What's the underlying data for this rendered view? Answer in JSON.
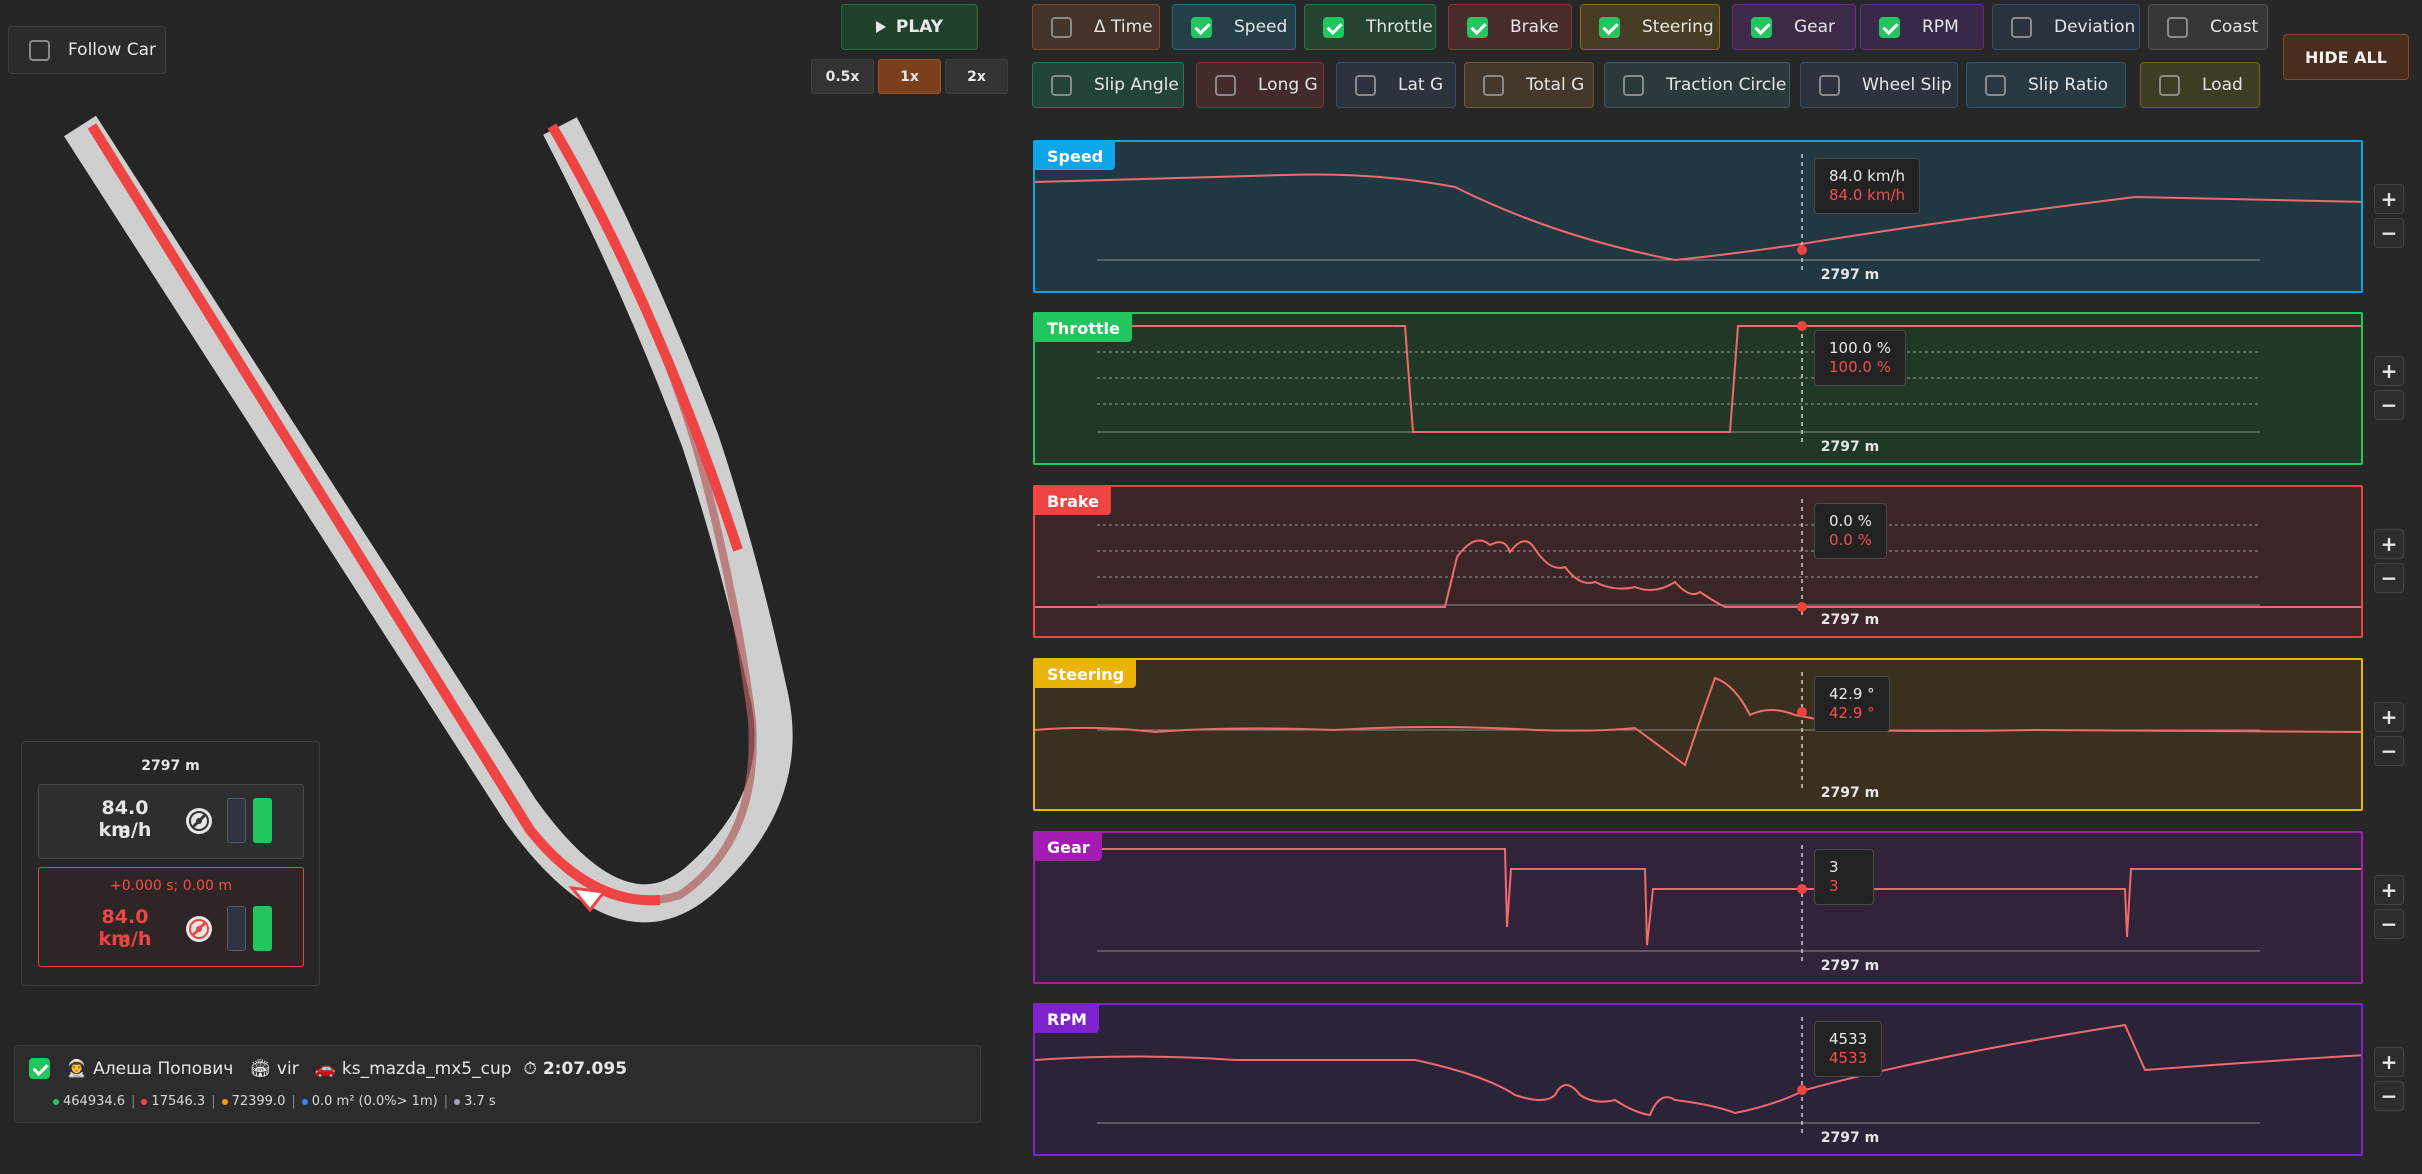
{
  "map": {
    "follow_car_label": "Follow Car",
    "follow_car_checked": false
  },
  "playback": {
    "play_label": "PLAY",
    "speeds": [
      "0.5x",
      "1x",
      "2x"
    ],
    "active_speed": "1x"
  },
  "channels": [
    {
      "label": "Δ Time",
      "checked": false,
      "color": "#7a4a2c"
    },
    {
      "label": "Speed",
      "checked": true,
      "color": "#1f6f8b"
    },
    {
      "label": "Throttle",
      "checked": true,
      "color": "#1f7a45"
    },
    {
      "label": "Brake",
      "checked": true,
      "color": "#8a3434"
    },
    {
      "label": "Steering",
      "checked": true,
      "color": "#8a6a1f"
    },
    {
      "label": "Gear",
      "checked": true,
      "color": "#6a2d8a"
    },
    {
      "label": "RPM",
      "checked": true,
      "color": "#5a2d8a"
    },
    {
      "label": "Deviation",
      "checked": false,
      "color": "#2f4a6a"
    },
    {
      "label": "Coast",
      "checked": false,
      "color": "#555555"
    },
    {
      "label": "Slip Angle",
      "checked": false,
      "color": "#1f7a5a"
    },
    {
      "label": "Long G",
      "checked": false,
      "color": "#7a3434"
    },
    {
      "label": "Lat G",
      "checked": false,
      "color": "#3a4a6a"
    },
    {
      "label": "Total G",
      "checked": false,
      "color": "#7a5a2c"
    },
    {
      "label": "Traction Circle",
      "checked": false,
      "color": "#3a5a6a"
    },
    {
      "label": "Wheel Slip",
      "checked": false,
      "color": "#3a4a6a"
    },
    {
      "label": "Slip Ratio",
      "checked": false,
      "color": "#2a5a7a"
    },
    {
      "label": "Load",
      "checked": false,
      "color": "#6a6a1f"
    }
  ],
  "hide_all_label": "HIDE ALL",
  "panels": [
    {
      "id": "speed",
      "title": "Speed",
      "color": "#0ea5e9",
      "bg": "#213742",
      "value_a": "84.0 km/h",
      "value_b": "84.0 km/h",
      "distance": "2797 m"
    },
    {
      "id": "throttle",
      "title": "Throttle",
      "color": "#22c55e",
      "bg": "#213827",
      "value_a": "100.0 %",
      "value_b": "100.0 %",
      "distance": "2797 m"
    },
    {
      "id": "brake",
      "title": "Brake",
      "color": "#ef4444",
      "bg": "#3a2626",
      "value_a": "0.0 %",
      "value_b": "0.0 %",
      "distance": "2797 m"
    },
    {
      "id": "steering",
      "title": "Steering",
      "color": "#eab308",
      "bg": "#3a3020",
      "value_a": "42.9 °",
      "value_b": "42.9 °",
      "distance": "2797 m"
    },
    {
      "id": "gear",
      "title": "Gear",
      "color": "#a21caf",
      "bg": "#30233a",
      "value_a": "3",
      "value_b": "3",
      "distance": "2797 m"
    },
    {
      "id": "rpm",
      "title": "RPM",
      "color": "#7e22ce",
      "bg": "#2b2338",
      "value_a": "4533",
      "value_b": "4533",
      "distance": "2797 m"
    }
  ],
  "info": {
    "distance": "2797 m",
    "car_a": {
      "speed": "84.0 km/h",
      "gear": "3"
    },
    "car_b": {
      "delta": "+0.000 s; 0.00 m",
      "speed": "84.0 km/h",
      "gear": "3"
    }
  },
  "session": {
    "checked": true,
    "driver_icon": "👨‍🚀",
    "driver": "Алеша Попович",
    "track_icon": "🏟",
    "track": "vir",
    "car_icon": "🚗",
    "car": "ks_mazda_mx5_cup",
    "time_icon": "⏱",
    "lap_time": "2:07.095",
    "stats": [
      {
        "text": "464934.6",
        "color": "#22c55e"
      },
      {
        "text": "17546.3",
        "color": "#ef4444"
      },
      {
        "text": "72399.0",
        "color": "#f59e0b"
      },
      {
        "text": "0.0 m² (0.0%> 1m)",
        "color": "#3b82f6"
      },
      {
        "text": "3.7 s",
        "color": "#9ca3af"
      }
    ]
  }
}
